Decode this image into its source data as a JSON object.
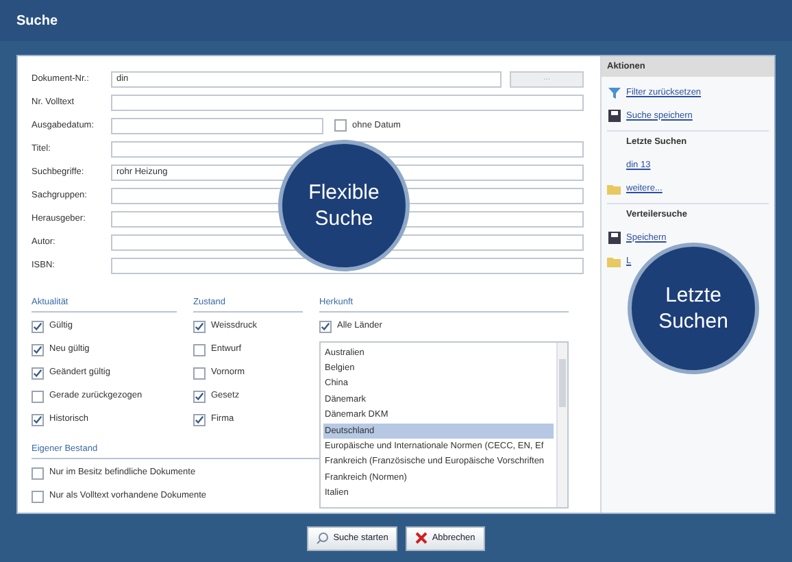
{
  "window": {
    "title": "Suche"
  },
  "fields": [
    {
      "kind": "button",
      "label": "Dokument-Nr.:",
      "value": "din",
      "button": "...",
      "button_disabled": true
    },
    {
      "kind": "text",
      "label": "Nr. Volltext"
    },
    {
      "kind": "date",
      "label": "Ausgabedatum:",
      "option": {
        "label": "ohne Datum",
        "checked": false
      }
    },
    {
      "kind": "text",
      "label": "Titel:"
    },
    {
      "kind": "text",
      "label": "Suchbegriffe:",
      "value": "rohr Heizung"
    },
    {
      "kind": "text",
      "label": "Sachgruppen:"
    },
    {
      "kind": "text",
      "label": "Herausgeber:"
    },
    {
      "kind": "text",
      "label": "Autor:"
    },
    {
      "kind": "text",
      "label": "ISBN:"
    }
  ],
  "aktualitaet": {
    "title": "Aktualität",
    "options": [
      {
        "label": "Gültig",
        "checked": true
      },
      {
        "label": "Neu gültig",
        "checked": true
      },
      {
        "label": "Geändert gültig",
        "checked": true
      },
      {
        "label": "Gerade zurückgezogen",
        "checked": false
      },
      {
        "label": "Historisch",
        "checked": true
      }
    ]
  },
  "zustand": {
    "title": "Zustand",
    "options": [
      {
        "label": "Weissdruck",
        "checked": true
      },
      {
        "label": "Entwurf",
        "checked": false
      },
      {
        "label": "Vornorm",
        "checked": false
      },
      {
        "label": "Gesetz",
        "checked": true
      },
      {
        "label": "Firma",
        "checked": true
      }
    ]
  },
  "eigener_bestand": {
    "title": "Eigener Bestand",
    "options": [
      {
        "label": "Nur im Besitz befindliche Dokumente",
        "checked": false
      },
      {
        "label": "Nur als Volltext vorhandene Dokumente",
        "checked": false
      }
    ]
  },
  "herkunft": {
    "title": "Herkunft",
    "all": {
      "label": "Alle Länder",
      "checked": true
    },
    "countries": [
      {
        "label": "Australien",
        "selected": false
      },
      {
        "label": "Belgien",
        "selected": false
      },
      {
        "label": "China",
        "selected": false
      },
      {
        "label": "Dänemark",
        "selected": false
      },
      {
        "label": "Dänemark DKM",
        "selected": false
      },
      {
        "label": "Deutschland",
        "selected": true
      },
      {
        "label": "Europäische und Internationale Normen (CECC, EN, Ef",
        "selected": false
      },
      {
        "label": "Frankreich (Französische und Europäische Vorschriften",
        "selected": false
      },
      {
        "label": "Frankreich (Normen)",
        "selected": false
      },
      {
        "label": "Italien",
        "selected": false
      }
    ]
  },
  "sidebar": {
    "header": "Aktionen",
    "items": [
      {
        "kind": "funnel",
        "label": "Filter zurücksetzen"
      },
      {
        "kind": "disk",
        "label": "Suche speichern"
      },
      {
        "kind": "heading",
        "label": "Letzte Suchen"
      },
      {
        "kind": "plain",
        "label": "din 13"
      },
      {
        "kind": "folder",
        "label": "weitere..."
      },
      {
        "kind": "heading",
        "label": "Verteilersuche"
      },
      {
        "kind": "disk",
        "label": "Speichern"
      },
      {
        "kind": "folder",
        "label": "L"
      }
    ]
  },
  "overlays": [
    {
      "lines": [
        "Flexible",
        "Suche"
      ]
    },
    {
      "lines": [
        "Letzte",
        "Suchen"
      ]
    }
  ],
  "buttons": [
    {
      "kind": "search",
      "label": "Suche starten"
    },
    {
      "kind": "cancel",
      "label": "Abbrechen"
    }
  ]
}
